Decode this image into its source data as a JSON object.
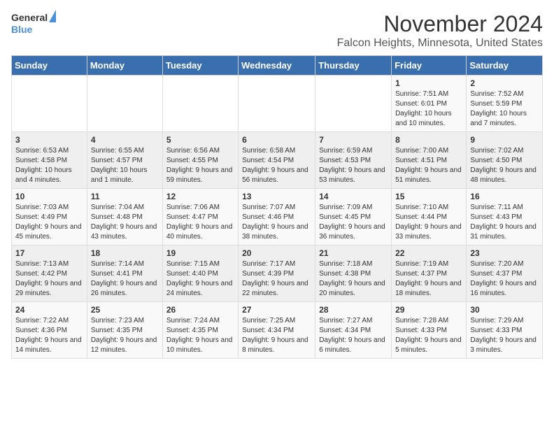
{
  "header": {
    "logo_general": "General",
    "logo_blue": "Blue",
    "month": "November 2024",
    "location": "Falcon Heights, Minnesota, United States"
  },
  "weekdays": [
    "Sunday",
    "Monday",
    "Tuesday",
    "Wednesday",
    "Thursday",
    "Friday",
    "Saturday"
  ],
  "weeks": [
    [
      {
        "day": "",
        "info": ""
      },
      {
        "day": "",
        "info": ""
      },
      {
        "day": "",
        "info": ""
      },
      {
        "day": "",
        "info": ""
      },
      {
        "day": "",
        "info": ""
      },
      {
        "day": "1",
        "info": "Sunrise: 7:51 AM\nSunset: 6:01 PM\nDaylight: 10 hours and 10 minutes."
      },
      {
        "day": "2",
        "info": "Sunrise: 7:52 AM\nSunset: 5:59 PM\nDaylight: 10 hours and 7 minutes."
      }
    ],
    [
      {
        "day": "3",
        "info": "Sunrise: 6:53 AM\nSunset: 4:58 PM\nDaylight: 10 hours and 4 minutes."
      },
      {
        "day": "4",
        "info": "Sunrise: 6:55 AM\nSunset: 4:57 PM\nDaylight: 10 hours and 1 minute."
      },
      {
        "day": "5",
        "info": "Sunrise: 6:56 AM\nSunset: 4:55 PM\nDaylight: 9 hours and 59 minutes."
      },
      {
        "day": "6",
        "info": "Sunrise: 6:58 AM\nSunset: 4:54 PM\nDaylight: 9 hours and 56 minutes."
      },
      {
        "day": "7",
        "info": "Sunrise: 6:59 AM\nSunset: 4:53 PM\nDaylight: 9 hours and 53 minutes."
      },
      {
        "day": "8",
        "info": "Sunrise: 7:00 AM\nSunset: 4:51 PM\nDaylight: 9 hours and 51 minutes."
      },
      {
        "day": "9",
        "info": "Sunrise: 7:02 AM\nSunset: 4:50 PM\nDaylight: 9 hours and 48 minutes."
      }
    ],
    [
      {
        "day": "10",
        "info": "Sunrise: 7:03 AM\nSunset: 4:49 PM\nDaylight: 9 hours and 45 minutes."
      },
      {
        "day": "11",
        "info": "Sunrise: 7:04 AM\nSunset: 4:48 PM\nDaylight: 9 hours and 43 minutes."
      },
      {
        "day": "12",
        "info": "Sunrise: 7:06 AM\nSunset: 4:47 PM\nDaylight: 9 hours and 40 minutes."
      },
      {
        "day": "13",
        "info": "Sunrise: 7:07 AM\nSunset: 4:46 PM\nDaylight: 9 hours and 38 minutes."
      },
      {
        "day": "14",
        "info": "Sunrise: 7:09 AM\nSunset: 4:45 PM\nDaylight: 9 hours and 36 minutes."
      },
      {
        "day": "15",
        "info": "Sunrise: 7:10 AM\nSunset: 4:44 PM\nDaylight: 9 hours and 33 minutes."
      },
      {
        "day": "16",
        "info": "Sunrise: 7:11 AM\nSunset: 4:43 PM\nDaylight: 9 hours and 31 minutes."
      }
    ],
    [
      {
        "day": "17",
        "info": "Sunrise: 7:13 AM\nSunset: 4:42 PM\nDaylight: 9 hours and 29 minutes."
      },
      {
        "day": "18",
        "info": "Sunrise: 7:14 AM\nSunset: 4:41 PM\nDaylight: 9 hours and 26 minutes."
      },
      {
        "day": "19",
        "info": "Sunrise: 7:15 AM\nSunset: 4:40 PM\nDaylight: 9 hours and 24 minutes."
      },
      {
        "day": "20",
        "info": "Sunrise: 7:17 AM\nSunset: 4:39 PM\nDaylight: 9 hours and 22 minutes."
      },
      {
        "day": "21",
        "info": "Sunrise: 7:18 AM\nSunset: 4:38 PM\nDaylight: 9 hours and 20 minutes."
      },
      {
        "day": "22",
        "info": "Sunrise: 7:19 AM\nSunset: 4:37 PM\nDaylight: 9 hours and 18 minutes."
      },
      {
        "day": "23",
        "info": "Sunrise: 7:20 AM\nSunset: 4:37 PM\nDaylight: 9 hours and 16 minutes."
      }
    ],
    [
      {
        "day": "24",
        "info": "Sunrise: 7:22 AM\nSunset: 4:36 PM\nDaylight: 9 hours and 14 minutes."
      },
      {
        "day": "25",
        "info": "Sunrise: 7:23 AM\nSunset: 4:35 PM\nDaylight: 9 hours and 12 minutes."
      },
      {
        "day": "26",
        "info": "Sunrise: 7:24 AM\nSunset: 4:35 PM\nDaylight: 9 hours and 10 minutes."
      },
      {
        "day": "27",
        "info": "Sunrise: 7:25 AM\nSunset: 4:34 PM\nDaylight: 9 hours and 8 minutes."
      },
      {
        "day": "28",
        "info": "Sunrise: 7:27 AM\nSunset: 4:34 PM\nDaylight: 9 hours and 6 minutes."
      },
      {
        "day": "29",
        "info": "Sunrise: 7:28 AM\nSunset: 4:33 PM\nDaylight: 9 hours and 5 minutes."
      },
      {
        "day": "30",
        "info": "Sunrise: 7:29 AM\nSunset: 4:33 PM\nDaylight: 9 hours and 3 minutes."
      }
    ]
  ]
}
